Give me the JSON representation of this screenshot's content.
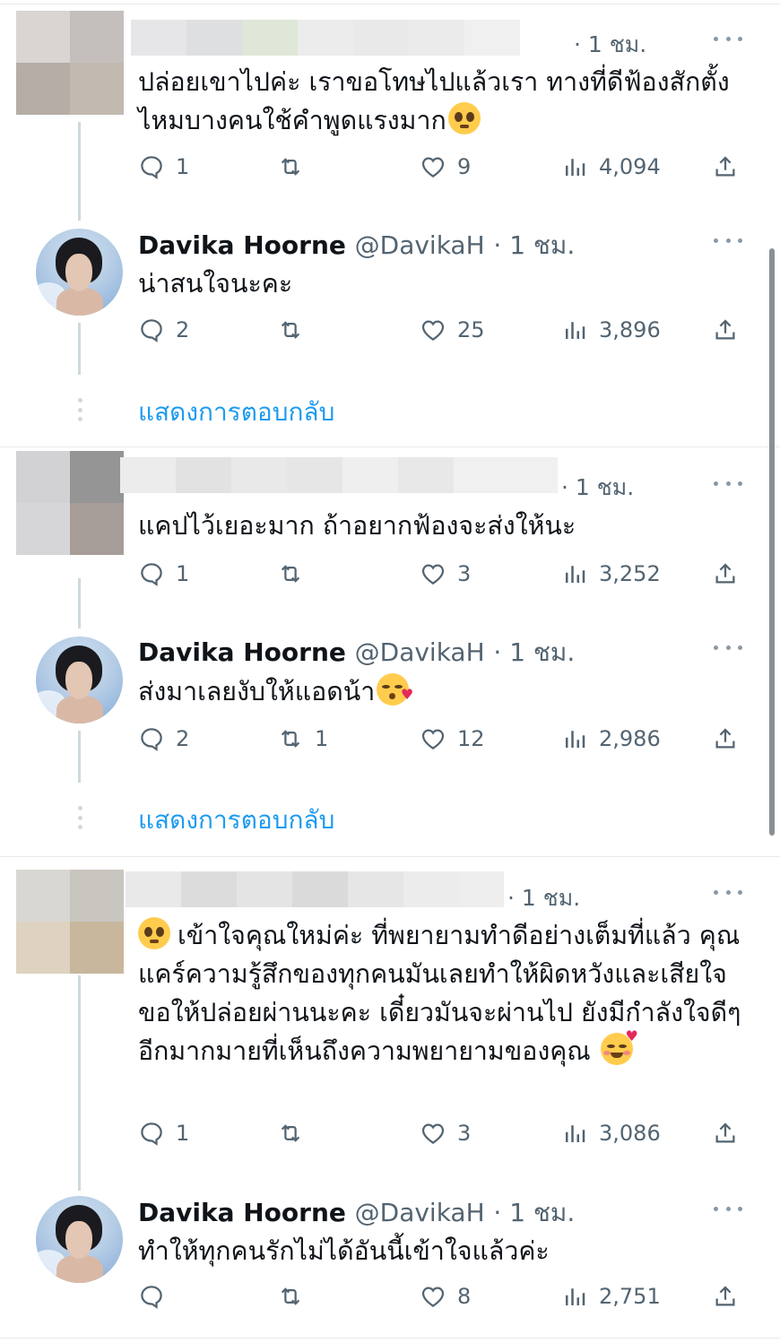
{
  "threads": [
    {
      "reply": {
        "time": "· 1 ชม.",
        "text": "ปล่อยเขาไปค่ะ เราขอโทษไปแล้วเรา ทางที่ดีฟ้องสักตั้งไหมบางคนใช้คำพูดแรงมาก",
        "emoji": "pleading-face",
        "stats": {
          "replies": "1",
          "retweets": "",
          "likes": "9",
          "views": "4,094"
        }
      },
      "answer": {
        "name": "Davika Hoorne",
        "handle": "@DavikaH",
        "time": "· 1 ชม.",
        "text": "น่าสนใจนะคะ",
        "stats": {
          "replies": "2",
          "retweets": "",
          "likes": "25",
          "views": "3,896"
        }
      },
      "show_replies": "แสดงการตอบกลับ"
    },
    {
      "reply": {
        "time": "· 1 ชม.",
        "text": "แคปไว้เยอะมาก ถ้าอยากฟ้องจะส่งให้นะ",
        "stats": {
          "replies": "1",
          "retweets": "",
          "likes": "3",
          "views": "3,252"
        }
      },
      "answer": {
        "name": "Davika Hoorne",
        "handle": "@DavikaH",
        "time": "· 1 ชม.",
        "text": "ส่งมาเลยงับให้แอดน้า",
        "emoji": "face-blowing-kiss",
        "stats": {
          "replies": "2",
          "retweets": "1",
          "likes": "12",
          "views": "2,986"
        }
      },
      "show_replies": "แสดงการตอบกลับ"
    },
    {
      "reply": {
        "time": "· 1 ชม.",
        "text_before_emoji": "",
        "emoji_lead": "pleading-face",
        "text": "เข้าใจคุณใหม่ค่ะ ที่พยายามทำดีอย่างเต็มที่แล้ว คุณแคร์ความรู้สึกของทุกคนมันเลยทำให้ผิดหวังและเสียใจ ขอให้ปล่อยผ่านนะคะ เดี๋ยวมันจะผ่านไป ยังมีกำลังใจดีๆอีกมากมายที่เห็นถึงความพยายามของคุณ",
        "emoji": "smiling-face-with-hearts",
        "stats": {
          "replies": "1",
          "retweets": "",
          "likes": "3",
          "views": "3,086"
        }
      },
      "answer": {
        "name": "Davika Hoorne",
        "handle": "@DavikaH",
        "time": "· 1 ชม.",
        "text": "ทำให้ทุกคนรักไม่ได้อันนี้เข้าใจแล้วค่ะ",
        "stats": {
          "replies": "",
          "retweets": "",
          "likes": "8",
          "views": "2,751"
        }
      }
    }
  ],
  "colors": {
    "link": "#1d9bf0",
    "muted": "#536471",
    "text": "#0f1419"
  }
}
